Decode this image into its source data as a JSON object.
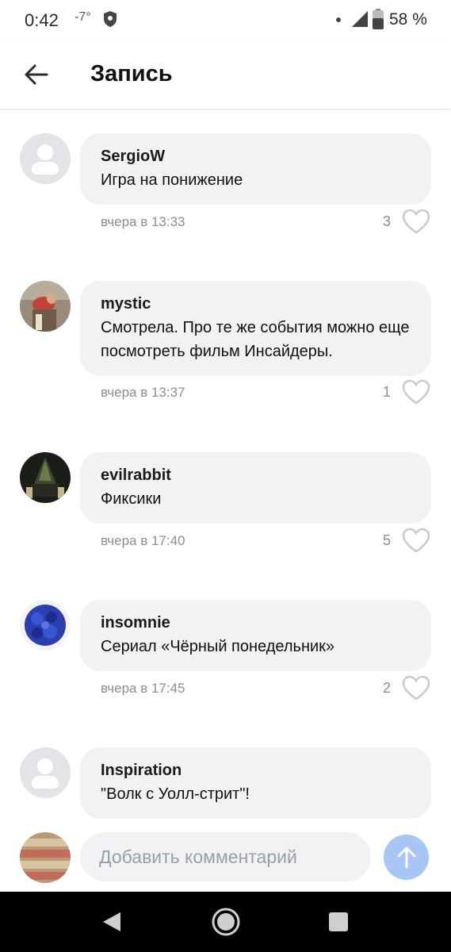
{
  "status_bar": {
    "time": "0:42",
    "temperature": "-7°",
    "battery": "58 %",
    "icons": [
      "shield-icon",
      "notification-dot-icon",
      "signal-icon",
      "battery-icon"
    ]
  },
  "header": {
    "title": "Запись",
    "back_icon": "arrow-left-icon"
  },
  "comments": [
    {
      "author": "SergioW",
      "text": "Игра на понижение",
      "time": "вчера в 13:33",
      "likes": "3",
      "avatar": "default"
    },
    {
      "author": "mystic",
      "text": "Смотрела. Про те же события можно еще посмотреть фильм Инсайдеры.",
      "time": "вчера в 13:37",
      "likes": "1",
      "avatar": "photo"
    },
    {
      "author": "evilrabbit",
      "text": "Фиксики",
      "time": "вчера в 17:40",
      "likes": "5",
      "avatar": "photo"
    },
    {
      "author": "insomnie",
      "text": "Сериал «Чёрный понедельник»",
      "time": "вчера в 17:45",
      "likes": "2",
      "avatar": "photo"
    },
    {
      "author": "Inspiration",
      "text": "\"Волк с Уолл-стрит\"!",
      "avatar": "default"
    }
  ],
  "composer": {
    "placeholder": "Добавить комментарий",
    "send_icon": "arrow-up-icon"
  },
  "colors": {
    "bubble": "#f1f2f4",
    "meta_text": "#8a8f96",
    "send_button": "#a7c6f5",
    "nav_bar": "#000000"
  }
}
